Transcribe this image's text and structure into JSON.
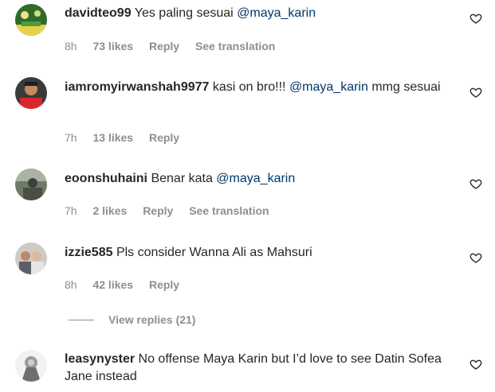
{
  "comments": [
    {
      "username": "davidteo99",
      "text_before": "Yes paling sesuai",
      "mention": "@maya_karin",
      "text_after": "",
      "time": "8h",
      "likes": "73 likes",
      "reply": "Reply",
      "translation": "See translation"
    },
    {
      "username": "iamromyirwanshah9977",
      "text_before": "kasi on bro!!!",
      "mention": "@maya_karin",
      "text_after": "mmg sesuai",
      "time": "7h",
      "likes": "13 likes",
      "reply": "Reply",
      "translation": ""
    },
    {
      "username": "eoonshuhaini",
      "text_before": "Benar kata",
      "mention": "@maya_karin",
      "text_after": "",
      "time": "7h",
      "likes": "2 likes",
      "reply": "Reply",
      "translation": "See translation"
    },
    {
      "username": "izzie585",
      "text_before": "Pls consider Wanna Ali as Mahsuri",
      "mention": "",
      "text_after": "",
      "time": "8h",
      "likes": "42 likes",
      "reply": "Reply",
      "translation": ""
    },
    {
      "username": "leasynyster",
      "text_before": "No offense Maya Karin but I’d love to see Datin Sofea Jane instead",
      "mention": "",
      "text_after": "",
      "time": "",
      "likes": "",
      "reply": "",
      "translation": ""
    }
  ],
  "view_replies": "View replies (21)",
  "icons": {
    "like": "heart-outline-icon"
  },
  "colors": {
    "text": "#262626",
    "secondary": "#8e8e8e",
    "mention": "#00376b"
  }
}
